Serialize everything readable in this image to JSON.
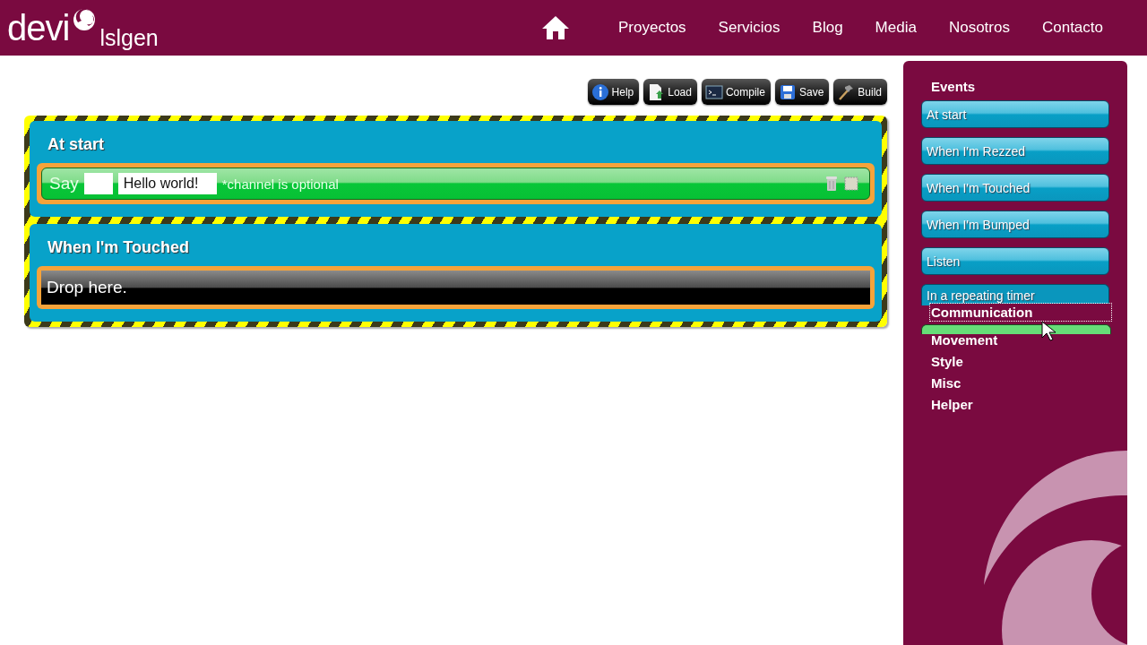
{
  "header": {
    "logo_word": "devi",
    "logo_sub": "lslgen",
    "nav": [
      {
        "label": "Proyectos"
      },
      {
        "label": "Servicios"
      },
      {
        "label": "Blog"
      },
      {
        "label": "Media"
      },
      {
        "label": "Nosotros"
      },
      {
        "label": "Contacto"
      }
    ]
  },
  "toolbar": [
    {
      "label": "Help",
      "kind": "info"
    },
    {
      "label": "Load",
      "kind": "file"
    },
    {
      "label": "Compile",
      "kind": "terminal"
    },
    {
      "label": "Save",
      "kind": "disk"
    },
    {
      "label": "Build",
      "kind": "hammer"
    }
  ],
  "blocks": [
    {
      "title": "At start",
      "slot": {
        "kind": "statement",
        "keyword": "Say",
        "message": "Hello world!",
        "note": "*channel is optional"
      }
    },
    {
      "title": "When I'm Touched",
      "slot": {
        "kind": "drop",
        "text": "Drop here."
      }
    }
  ],
  "palette": {
    "categories": [
      {
        "label": "Events",
        "focused": false,
        "items": [
          {
            "label": "At start",
            "clipped": false
          },
          {
            "label": "When I'm Rezzed",
            "clipped": false
          },
          {
            "label": "When I'm Touched",
            "clipped": false
          },
          {
            "label": "When I'm Bumped",
            "clipped": false
          },
          {
            "label": "Listen",
            "clipped": false
          },
          {
            "label": "In a repeating timer",
            "clipped": true
          }
        ]
      },
      {
        "label": "Communication",
        "focused": true
      },
      {
        "label": "Movement",
        "focused": false
      },
      {
        "label": "Style",
        "focused": false
      },
      {
        "label": "Misc",
        "focused": false
      },
      {
        "label": "Helper",
        "focused": false
      }
    ]
  }
}
